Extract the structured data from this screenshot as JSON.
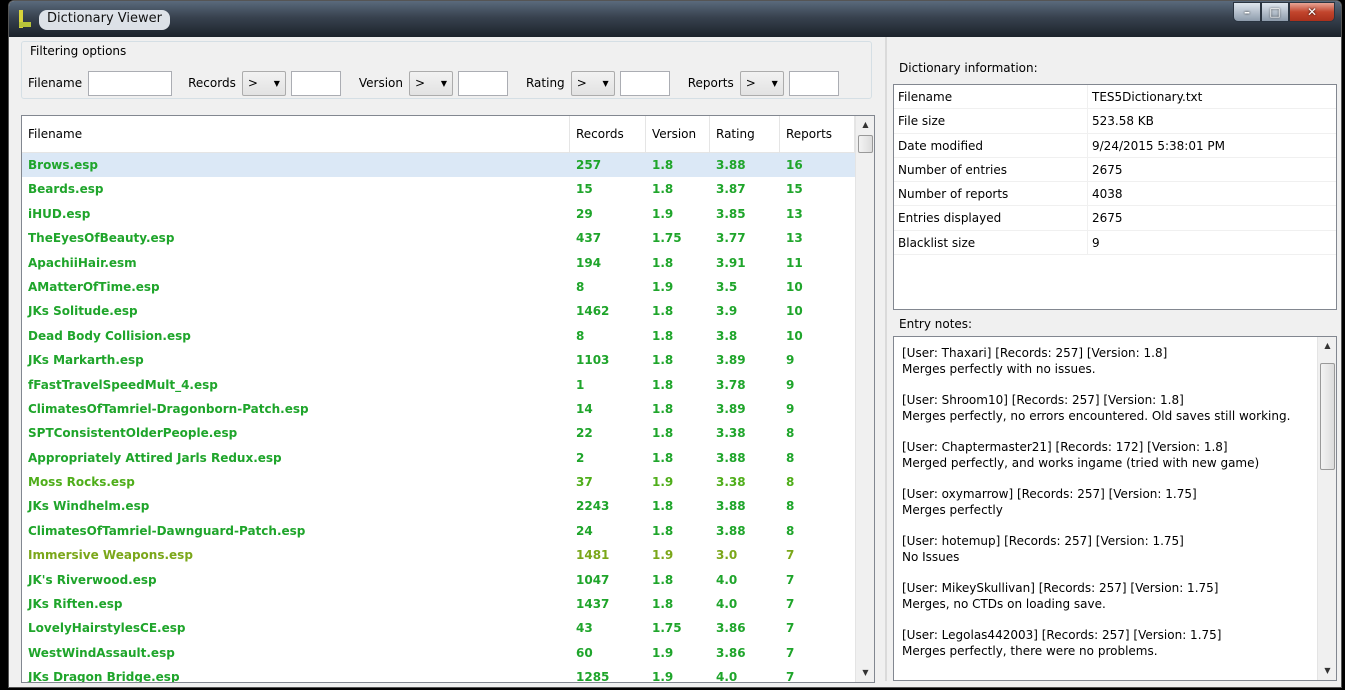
{
  "window": {
    "title": "Dictionary Viewer",
    "min": "–",
    "max": "□",
    "close": "✕"
  },
  "filter": {
    "legend": "Filtering options",
    "filename_label": "Filename",
    "records_label": "Records",
    "version_label": "Version",
    "rating_label": "Rating",
    "reports_label": "Reports",
    "op": ">",
    "filename_value": "",
    "records_value": "",
    "version_value": "",
    "rating_value": "",
    "reports_value": ""
  },
  "table": {
    "columns": [
      "Filename",
      "Records",
      "Version",
      "Rating",
      "Reports"
    ],
    "rows": [
      {
        "file": "Brows.esp",
        "records": "257",
        "version": "1.8",
        "rating": "3.88",
        "reports": "16",
        "color": "#1fa52b",
        "selected": true
      },
      {
        "file": "Beards.esp",
        "records": "15",
        "version": "1.8",
        "rating": "3.87",
        "reports": "15",
        "color": "#1fa52b"
      },
      {
        "file": "iHUD.esp",
        "records": "29",
        "version": "1.9",
        "rating": "3.85",
        "reports": "13",
        "color": "#1fa52b"
      },
      {
        "file": "TheEyesOfBeauty.esp",
        "records": "437",
        "version": "1.75",
        "rating": "3.77",
        "reports": "13",
        "color": "#1fa52b"
      },
      {
        "file": "ApachiiHair.esm",
        "records": "194",
        "version": "1.8",
        "rating": "3.91",
        "reports": "11",
        "color": "#1fa52b"
      },
      {
        "file": "AMatterOfTime.esp",
        "records": "8",
        "version": "1.9",
        "rating": "3.5",
        "reports": "10",
        "color": "#1fa52b"
      },
      {
        "file": "JKs Solitude.esp",
        "records": "1462",
        "version": "1.8",
        "rating": "3.9",
        "reports": "10",
        "color": "#1fa52b"
      },
      {
        "file": "Dead Body Collision.esp",
        "records": "8",
        "version": "1.8",
        "rating": "3.8",
        "reports": "10",
        "color": "#1fa52b"
      },
      {
        "file": "JKs Markarth.esp",
        "records": "1103",
        "version": "1.8",
        "rating": "3.89",
        "reports": "9",
        "color": "#1fa52b"
      },
      {
        "file": "fFastTravelSpeedMult_4.esp",
        "records": "1",
        "version": "1.8",
        "rating": "3.78",
        "reports": "9",
        "color": "#1fa52b"
      },
      {
        "file": "ClimatesOfTamriel-Dragonborn-Patch.esp",
        "records": "14",
        "version": "1.8",
        "rating": "3.89",
        "reports": "9",
        "color": "#1fa52b"
      },
      {
        "file": "SPTConsistentOlderPeople.esp",
        "records": "22",
        "version": "1.8",
        "rating": "3.38",
        "reports": "8",
        "color": "#1fa52b"
      },
      {
        "file": "Appropriately Attired Jarls Redux.esp",
        "records": "2",
        "version": "1.8",
        "rating": "3.88",
        "reports": "8",
        "color": "#1fa52b"
      },
      {
        "file": "Moss Rocks.esp",
        "records": "37",
        "version": "1.9",
        "rating": "3.38",
        "reports": "8",
        "color": "#4fae1a"
      },
      {
        "file": "JKs Windhelm.esp",
        "records": "2243",
        "version": "1.8",
        "rating": "3.88",
        "reports": "8",
        "color": "#1fa52b"
      },
      {
        "file": "ClimatesOfTamriel-Dawnguard-Patch.esp",
        "records": "24",
        "version": "1.8",
        "rating": "3.88",
        "reports": "8",
        "color": "#1fa52b"
      },
      {
        "file": "Immersive Weapons.esp",
        "records": "1481",
        "version": "1.9",
        "rating": "3.0",
        "reports": "7",
        "color": "#7ba71a"
      },
      {
        "file": "JK's Riverwood.esp",
        "records": "1047",
        "version": "1.8",
        "rating": "4.0",
        "reports": "7",
        "color": "#1fa52b"
      },
      {
        "file": "JKs Riften.esp",
        "records": "1437",
        "version": "1.8",
        "rating": "4.0",
        "reports": "7",
        "color": "#1fa52b"
      },
      {
        "file": "LovelyHairstylesCE.esp",
        "records": "43",
        "version": "1.75",
        "rating": "3.86",
        "reports": "7",
        "color": "#1fa52b"
      },
      {
        "file": "WestWindAssault.esp",
        "records": "60",
        "version": "1.9",
        "rating": "3.86",
        "reports": "7",
        "color": "#1fa52b"
      },
      {
        "file": "JKs Dragon Bridge.esp",
        "records": "1285",
        "version": "1.9",
        "rating": "4.0",
        "reports": "7",
        "color": "#1fa52b"
      }
    ]
  },
  "info": {
    "title": "Dictionary information:",
    "rows": [
      {
        "key": "Filename",
        "value": "TES5Dictionary.txt"
      },
      {
        "key": "File size",
        "value": "523.58 KB"
      },
      {
        "key": "Date modified",
        "value": "9/24/2015 5:38:01 PM"
      },
      {
        "key": "Number of entries",
        "value": "2675"
      },
      {
        "key": "Number of reports",
        "value": "4038"
      },
      {
        "key": "Entries displayed",
        "value": "2675"
      },
      {
        "key": "Blacklist size",
        "value": "9"
      }
    ]
  },
  "notes": {
    "title": "Entry notes:",
    "entries": [
      {
        "header": "[User: Thaxari] [Records: 257] [Version: 1.8]",
        "body": "Merges perfectly with no issues."
      },
      {
        "header": "[User: Shroom10] [Records: 257] [Version: 1.8]",
        "body": "Merges perfectly, no errors encountered. Old saves still working."
      },
      {
        "header": "[User: Chaptermaster21] [Records: 172] [Version: 1.8]",
        "body": "Merged perfectly, and works ingame (tried with new game)"
      },
      {
        "header": "[User: oxymarrow] [Records: 257] [Version: 1.75]",
        "body": "Merges perfectly"
      },
      {
        "header": "[User: hotemup] [Records: 257] [Version: 1.75]",
        "body": "No Issues"
      },
      {
        "header": "[User: MikeySkullivan] [Records: 257] [Version: 1.75]",
        "body": "Merges, no CTDs on loading save."
      },
      {
        "header": "[User: Legolas442003] [Records: 257] [Version: 1.75]",
        "body": "Merges perfectly, there were no problems."
      }
    ]
  }
}
